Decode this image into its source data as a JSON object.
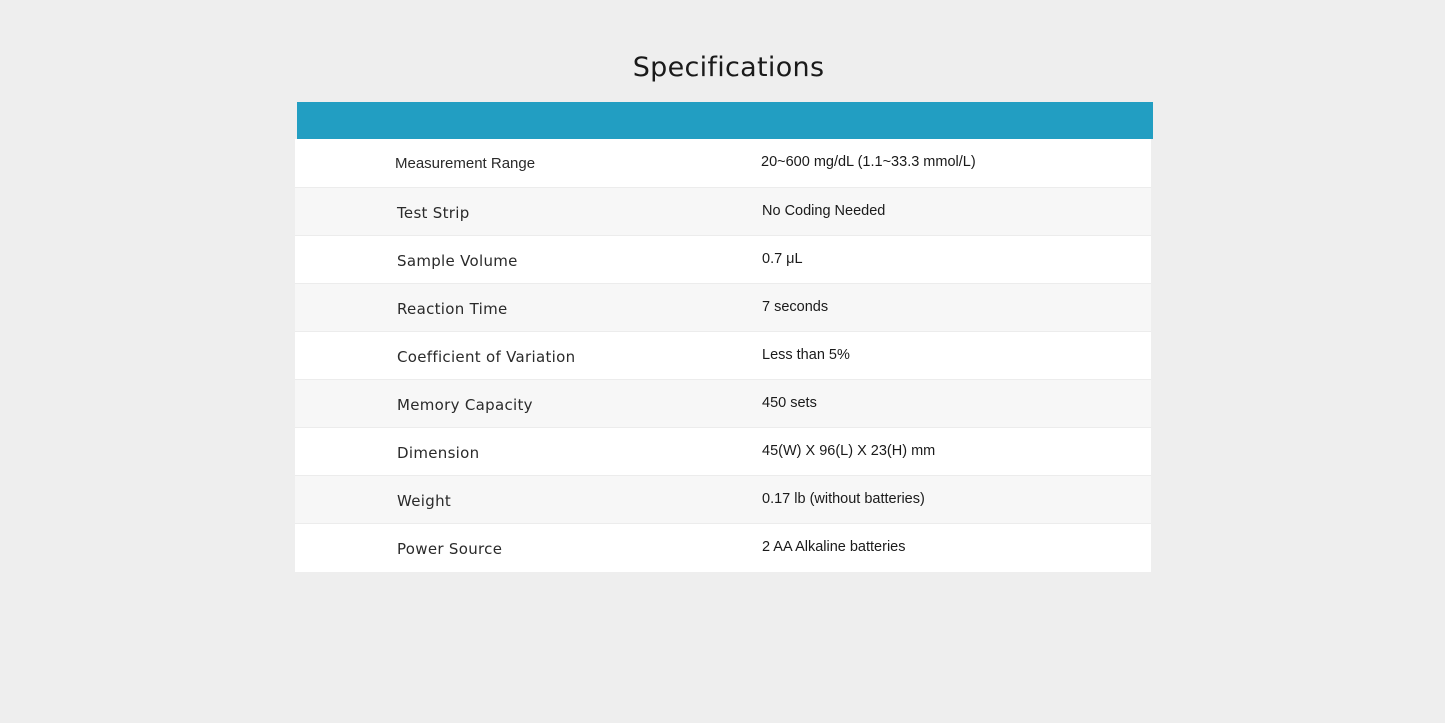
{
  "page": {
    "title": "Specifications"
  },
  "colors": {
    "header_bar": "#229ec2",
    "background": "#eeeeee",
    "row_odd": "#ffffff",
    "row_even": "#f7f7f7"
  },
  "specs": [
    {
      "label": "Measurement Range",
      "value": "20~600 mg/dL (1.1~33.3 mmol/L)"
    },
    {
      "label": "Test Strip",
      "value": "No Coding Needed"
    },
    {
      "label": "Sample Volume",
      "value": "0.7 μL"
    },
    {
      "label": "Reaction Time",
      "value": "7 seconds"
    },
    {
      "label": "Coefficient of Variation",
      "value": "Less than 5%"
    },
    {
      "label": "Memory Capacity",
      "value": "450 sets"
    },
    {
      "label": "Dimension",
      "value": "45(W) X 96(L) X 23(H) mm"
    },
    {
      "label": "Weight",
      "value": "0.17 lb (without batteries)"
    },
    {
      "label": "Power Source",
      "value": "2 AA Alkaline batteries"
    }
  ]
}
